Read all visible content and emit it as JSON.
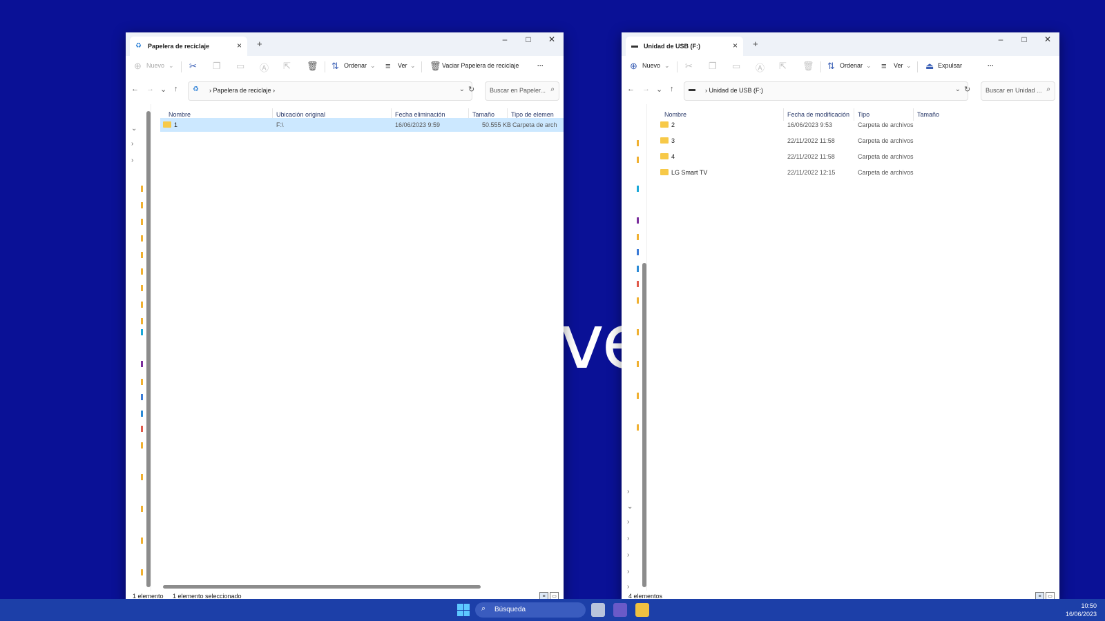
{
  "wallpaper": {
    "text": "ve"
  },
  "left_window": {
    "tab_title": "Papelera de reciclaje",
    "toolbar": {
      "nuevo": "Nuevo",
      "ordenar": "Ordenar",
      "ver": "Ver",
      "vaciar": "Vaciar Papelera de reciclaje",
      "more": "···"
    },
    "address": "Papelera de reciclaje",
    "search_placeholder": "Buscar en Papeler...",
    "columns": [
      "Nombre",
      "Ubicación original",
      "Fecha eliminación",
      "Tamaño",
      "Tipo de elemen"
    ],
    "rows": [
      {
        "name": "1",
        "location": "F:\\",
        "date": "16/06/2023 9:59",
        "size": "50.555 KB",
        "type": "Carpeta de arch"
      }
    ],
    "status_count": "1 elemento",
    "status_selected": "1 elemento seleccionado"
  },
  "right_window": {
    "tab_title": "Unidad de USB (F:)",
    "toolbar": {
      "nuevo": "Nuevo",
      "ordenar": "Ordenar",
      "ver": "Ver",
      "expulsar": "Expulsar",
      "more": "···"
    },
    "address": "Unidad de USB (F:)",
    "search_placeholder": "Buscar en Unidad ...",
    "columns": [
      "Nombre",
      "Fecha de modificación",
      "Tipo",
      "Tamaño"
    ],
    "rows": [
      {
        "name": "2",
        "date": "16/06/2023 9:53",
        "type": "Carpeta de archivos"
      },
      {
        "name": "3",
        "date": "22/11/2022 11:58",
        "type": "Carpeta de archivos"
      },
      {
        "name": "4",
        "date": "22/11/2022 11:58",
        "type": "Carpeta de archivos"
      },
      {
        "name": "LG Smart TV",
        "date": "22/11/2022 12:15",
        "type": "Carpeta de archivos"
      }
    ],
    "status_count": "4 elementos"
  },
  "taskbar": {
    "search_label": "Búsqueda",
    "time": "10:50",
    "date": "16/06/2023"
  },
  "colors": {
    "wallpaper": "#0a1196",
    "selection": "#cce8ff",
    "taskbar": "#1c3fa8",
    "folder": "#f7c948"
  }
}
